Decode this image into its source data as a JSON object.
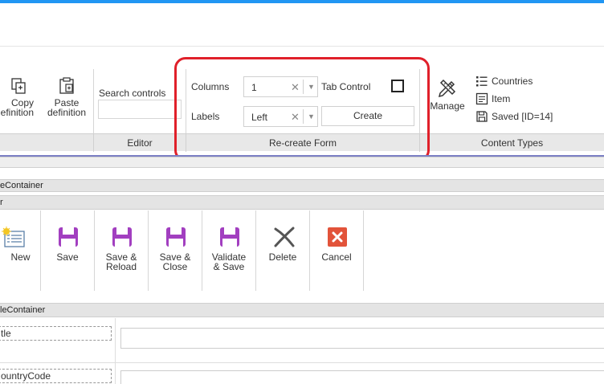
{
  "ribbon": {
    "clipboard": {
      "copy_label_1": "Copy",
      "copy_label_2": "definition",
      "paste_label_1": "Paste",
      "paste_label_2": "definition"
    },
    "editor": {
      "search_label": "Search controls",
      "search_value": "",
      "group_label": "Editor"
    },
    "recreate": {
      "columns_label": "Columns",
      "columns_value": "1",
      "labels_label": "Labels",
      "labels_value": "Left",
      "tab_control_label": "Tab Control",
      "tab_control_checked": false,
      "create_label": "Create",
      "group_label": "Re-create Form"
    },
    "content_types": {
      "manage_label": "Manage",
      "countries_label": "Countries",
      "item_label": "Item",
      "saved_label": "Saved [ID=14]",
      "group_label": "Content Types"
    }
  },
  "form": {
    "container_1": "eContainer",
    "toolbar_band": "r",
    "toolbar": {
      "new": "New",
      "save": "Save",
      "save_reload_1": "Save &",
      "save_reload_2": "Reload",
      "save_close_1": "Save &",
      "save_close_2": "Close",
      "validate_save_1": "Validate",
      "validate_save_2": "& Save",
      "delete": "Delete",
      "cancel": "Cancel"
    },
    "container_2": "leContainer",
    "fields": [
      {
        "label": "tle",
        "value": ""
      },
      {
        "label": "ountryCode",
        "value": ""
      }
    ]
  },
  "colors": {
    "accent_blue": "#2196f3",
    "highlight_red": "#e0202a",
    "save_purple": "#a23fc0",
    "cancel_orange": "#e2533a",
    "divider_purple": "#7b7fc4"
  }
}
